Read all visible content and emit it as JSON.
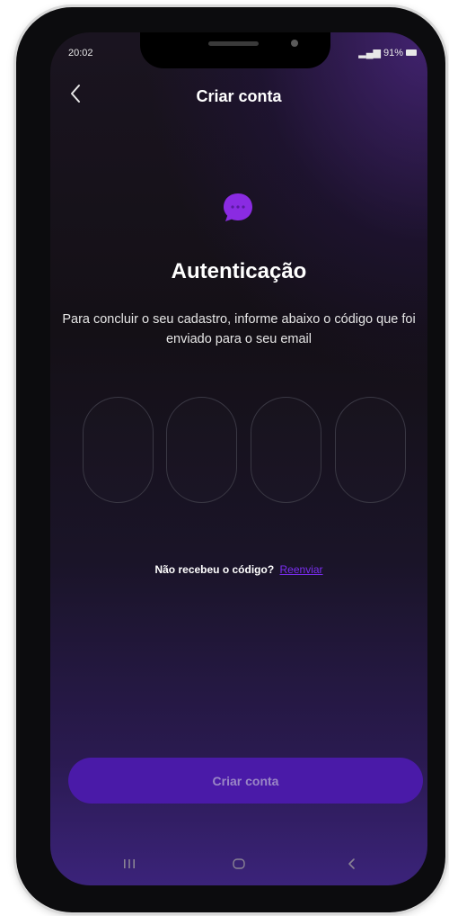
{
  "status_bar": {
    "time": "20:02",
    "battery": "91%"
  },
  "header": {
    "back_icon": "chevron-left-icon",
    "title": "Criar conta"
  },
  "auth": {
    "icon": "chat-bubble-icon",
    "heading": "Autenticação",
    "description": "Para concluir o seu cadastro, informe abaixo o código que foi enviado para o seu email",
    "code_fields": [
      "",
      "",
      "",
      ""
    ]
  },
  "resend": {
    "question": "Não recebeu o código?",
    "link": "Reenviar"
  },
  "actions": {
    "submit_label": "Criar conta"
  },
  "nav_bar": {
    "recent_icon": "recents-icon",
    "home_icon": "home-icon",
    "back_icon": "back-icon"
  },
  "colors": {
    "accent": "#7a2df0",
    "button": "#4a1aa8",
    "icon": "#8a2be2"
  }
}
